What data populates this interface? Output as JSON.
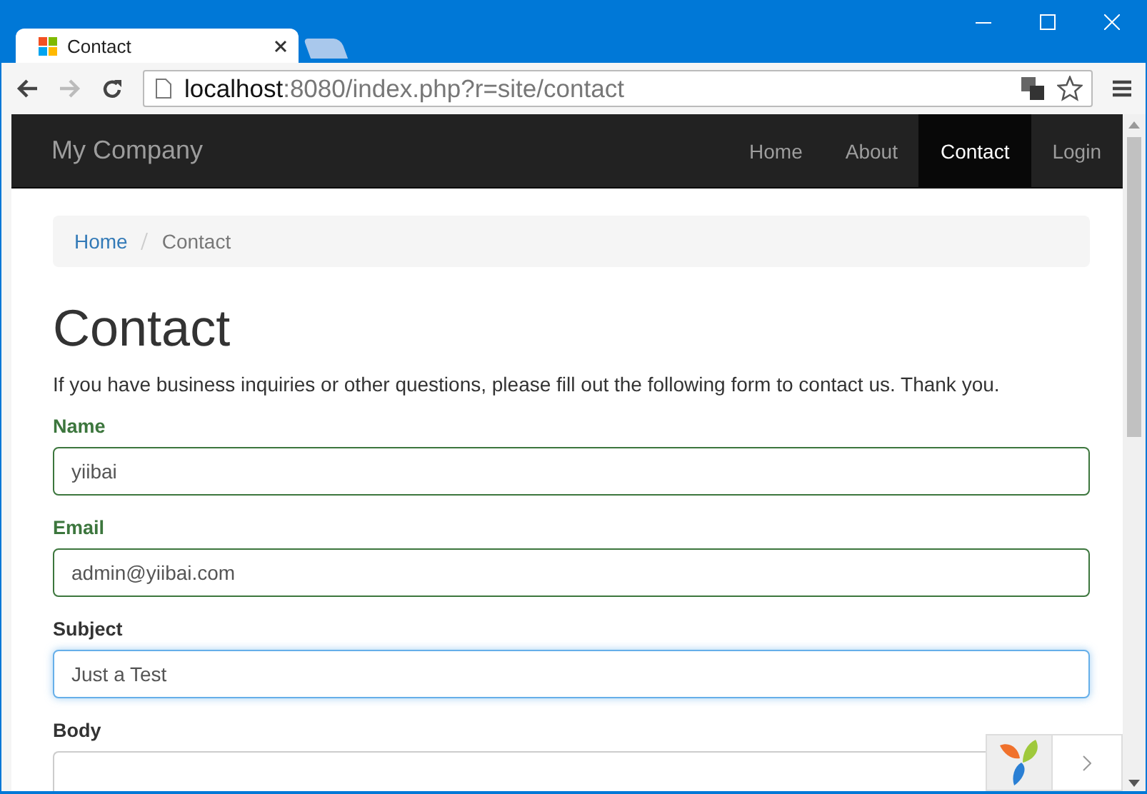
{
  "window": {
    "tab_title": "Contact"
  },
  "address_bar": {
    "host": "localhost",
    "rest": ":8080/index.php?r=site/contact"
  },
  "navbar": {
    "brand": "My Company",
    "items": [
      {
        "label": "Home",
        "selected": false
      },
      {
        "label": "About",
        "selected": false
      },
      {
        "label": "Contact",
        "selected": true
      },
      {
        "label": "Login",
        "selected": false
      }
    ]
  },
  "breadcrumb": [
    {
      "label": "Home",
      "kind": "link"
    },
    {
      "label": "Contact",
      "kind": "current"
    }
  ],
  "page_title": "Contact",
  "intro": "If you have business inquiries or other questions, please fill out the following form to contact us. Thank you.",
  "fields": [
    {
      "label": "Name",
      "value": "yiibai",
      "valid": true,
      "focused": false
    },
    {
      "label": "Email",
      "value": "admin@yiibai.com",
      "valid": true,
      "focused": false
    },
    {
      "label": "Subject",
      "value": "Just a Test",
      "valid": false,
      "focused": true
    },
    {
      "label": "Body",
      "valid": false,
      "focused": false
    }
  ]
}
